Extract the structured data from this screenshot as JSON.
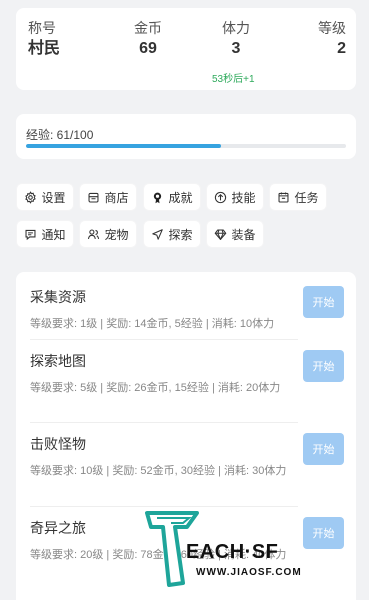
{
  "stats": {
    "title_label": "称号",
    "title_value": "村民",
    "coins_label": "金币",
    "coins_value": "69",
    "stamina_label": "体力",
    "stamina_value": "3",
    "stamina_regen": "53秒后+1",
    "level_label": "等级",
    "level_value": "2"
  },
  "experience": {
    "label": "经验: 61/100",
    "progress": 0.61,
    "color": "#36a3e0"
  },
  "actions": [
    {
      "label": "设置",
      "icon": "gear-icon"
    },
    {
      "label": "商店",
      "icon": "store-icon"
    },
    {
      "label": "成就",
      "icon": "medal-icon"
    },
    {
      "label": "技能",
      "icon": "arrow-up-circle-icon"
    },
    {
      "label": "任务",
      "icon": "calendar-icon"
    },
    {
      "label": "通知",
      "icon": "message-icon"
    },
    {
      "label": "宠物",
      "icon": "pet-icon"
    },
    {
      "label": "探索",
      "icon": "navigation-icon"
    },
    {
      "label": "装备",
      "icon": "diamond-icon"
    }
  ],
  "tasks": [
    {
      "name": "采集资源",
      "desc": "等级要求: 1级 | 奖励: 14金币, 5经验 | 消耗: 10体力",
      "button": "开始"
    },
    {
      "name": "探索地图",
      "desc": "等级要求: 5级 | 奖励: 26金币, 15经验 | 消耗: 20体力",
      "button": "开始"
    },
    {
      "name": "击败怪物",
      "desc": "等级要求: 10级 | 奖励: 52金币, 30经验 | 消耗: 30体力",
      "button": "开始"
    },
    {
      "name": "奇异之旅",
      "desc": "等级要求: 20级 | 奖励: 78金币, 60经验 | 消耗: 40体力",
      "button": "开始"
    }
  ],
  "watermark": {
    "brand": "EACH·SF",
    "url": "WWW.JIAOSF.COM"
  },
  "colors": {
    "accent": "#36a3e0",
    "button": "#9fcaf3",
    "regen": "#2eaa5c",
    "watermark": "#1ea59a"
  }
}
